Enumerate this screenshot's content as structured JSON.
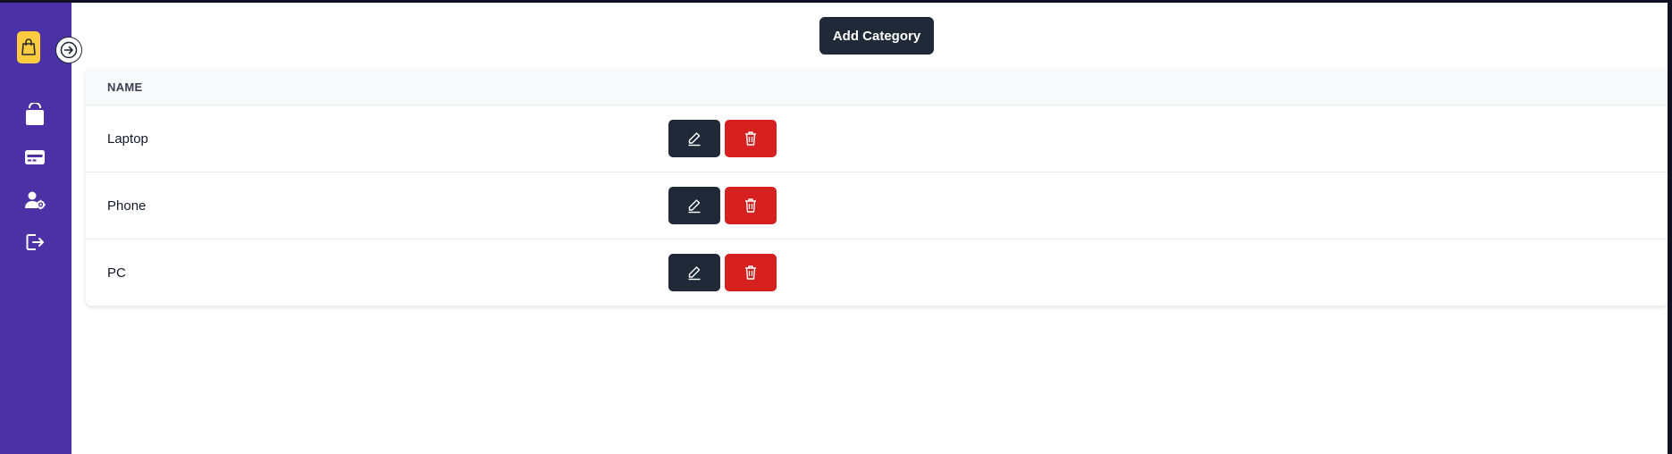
{
  "header": {
    "add_button_label": "Add Category"
  },
  "table": {
    "columns": [
      "NAME"
    ],
    "rows": [
      {
        "name": "Laptop"
      },
      {
        "name": "Phone"
      },
      {
        "name": "PC"
      }
    ]
  },
  "sidebar": {
    "logo_icon": "shopping-bag-icon",
    "toggle_icon": "arrow-right-icon",
    "items": [
      {
        "icon": "shopping-bag-icon"
      },
      {
        "icon": "credit-card-icon"
      },
      {
        "icon": "user-settings-icon"
      },
      {
        "icon": "logout-icon"
      }
    ]
  },
  "colors": {
    "sidebar": "#4c31a6",
    "logo": "#fbcc3f",
    "primary_button": "#1f2937",
    "danger_button": "#d61f1f"
  }
}
